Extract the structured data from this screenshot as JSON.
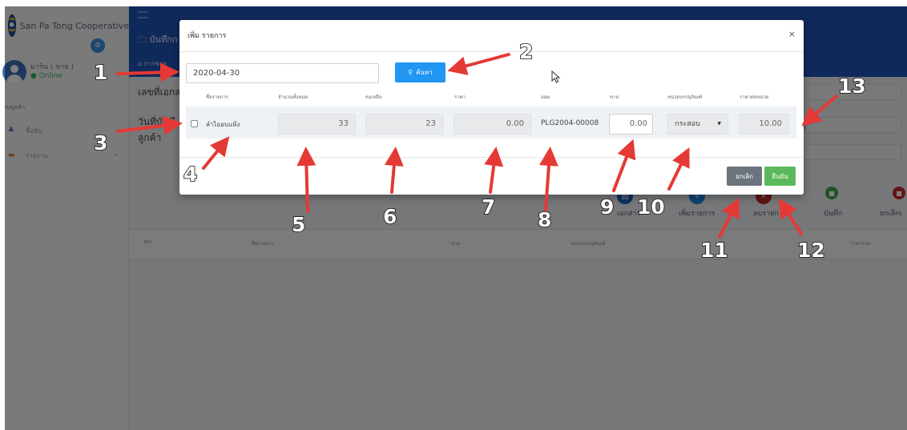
{
  "app": {
    "brand_name": "San Pa Tong Cooperative",
    "user_name": "มาริน ( ขาย )",
    "user_status": "Online",
    "menu_title": "เมนูหลัก",
    "menu_items": [
      {
        "label": "ซื้อขับ",
        "icon": "users-icon"
      },
      {
        "label": "รายงาน",
        "icon": "folder-icon"
      }
    ],
    "page_title": "บันทึกก",
    "breadcrumb": "การขาย",
    "labels": {
      "doc_no": "เลขที่เอกส",
      "record_date": "วันที่บันทึ",
      "customer": "ลูกค้า",
      "right_field": "ที่"
    },
    "actions": [
      {
        "label": "เอกสาร",
        "color": "#1565c0"
      },
      {
        "label": "เพิ่มรายการ",
        "color": "#1e88e5"
      },
      {
        "label": "ลบรายก",
        "color": "#c62828"
      },
      {
        "label": "บันทึก",
        "color": "#43a047"
      },
      {
        "label": "ยกเลิกเ",
        "color": "#c62828"
      }
    ],
    "table_headers": {
      "no": "NO.",
      "name": "ชื่อรายการ",
      "sell": "ขาย",
      "unit": "หน่วยบรรจุภัณฑ์",
      "total": "ราคารวม"
    }
  },
  "modal": {
    "title": "เพิ่ม รายการ",
    "close_icon": "×",
    "date_value": "2020-04-30",
    "search_label": "ค้นหา",
    "columns": [
      "ชื่อรายการ",
      "จำนวนทั้งหมด",
      "คงเหลือ",
      "ราคา",
      "ลอต",
      "ขาย",
      "หน่วยบรรจุภัณฑ์",
      "ราคาต่อหน่วย"
    ],
    "row": {
      "name": "ลำไยอบแห้ง",
      "total_qty": "33",
      "remaining": "23",
      "price": "0.00",
      "lot": "PLG2004-00008",
      "sell": "0.00",
      "unit": "กระสอบ",
      "unit_price": "10.00"
    },
    "cancel_label": "ยกเลิก",
    "confirm_label": "ยืนยัน"
  },
  "annotations": [
    "1",
    "2",
    "3",
    "4",
    "5",
    "6",
    "7",
    "8",
    "9",
    "10",
    "11",
    "12",
    "13"
  ],
  "colors": {
    "topbar": "#2052b6",
    "arrow": "#e53935",
    "search_button": "#2196f3",
    "cancel_button": "#6c757d",
    "confirm_button": "#5cb85c"
  }
}
